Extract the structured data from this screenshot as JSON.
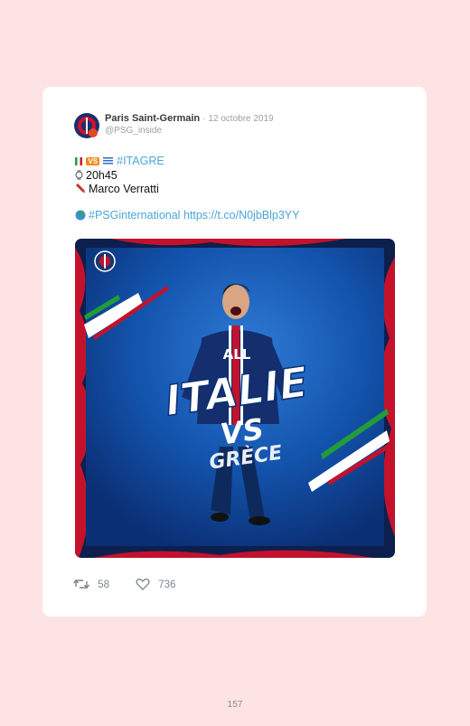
{
  "tweet": {
    "author_name": "Paris Saint-Germain",
    "date": "· 12 octobre 2019",
    "handle": "@PSG_inside",
    "vs_badge": "VS",
    "hashtag_match": "#ITAGRE",
    "time": "20h45",
    "player": "Marco Verratti",
    "hashtag_intl": "#PSGinternational",
    "link": "https://t.co/N0jbBlp3YY"
  },
  "media": {
    "title_line1": "ITALIE",
    "title_vs": "VS",
    "title_line2": "GRÈCE",
    "shirt_text": "ALL"
  },
  "actions": {
    "retweets": "58",
    "likes": "736"
  },
  "page_number": "157",
  "colors": {
    "background": "#fde3e3",
    "psg_blue": "#0a3d9c",
    "psg_red": "#d0112b",
    "link": "#4aa6d8"
  }
}
